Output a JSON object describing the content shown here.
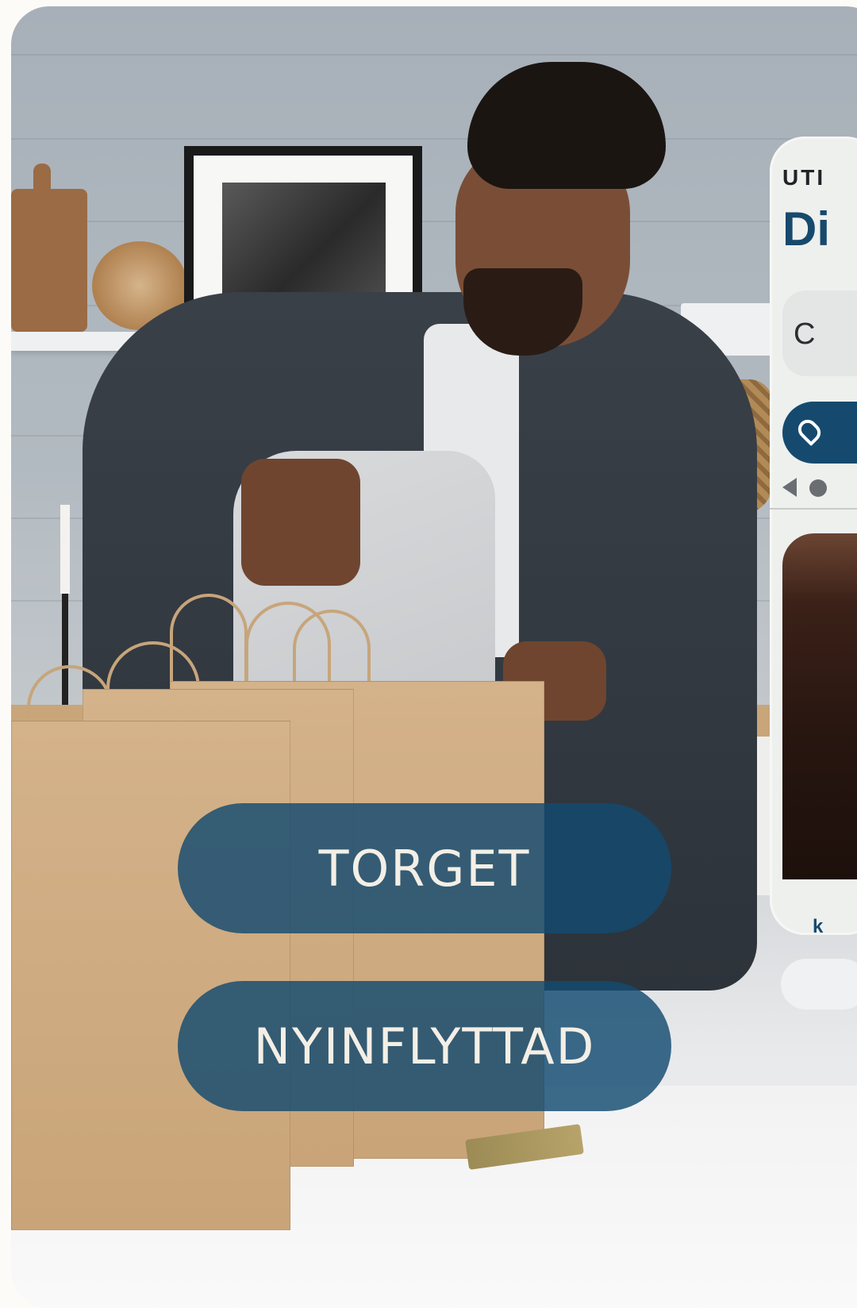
{
  "hero": {
    "image_alt": "Man packing a grey hoodie into brown paper shopping bags in a kitchen"
  },
  "buttons": {
    "torget": "TORGET",
    "nyinflyttad": "NYINFLYTTAD"
  },
  "preview_card": {
    "kicker": "UTI",
    "title": "Di",
    "input_text": "C",
    "below_text": "k"
  },
  "colors": {
    "pill_background": "#124a70",
    "pill_text": "#f4efe6",
    "brand_blue": "#17496d",
    "page_background": "#fdfbf8"
  },
  "icons": {
    "location": "location-pin-icon",
    "carousel_prev": "chevron-left-icon",
    "carousel_dot": "carousel-dot-icon"
  }
}
